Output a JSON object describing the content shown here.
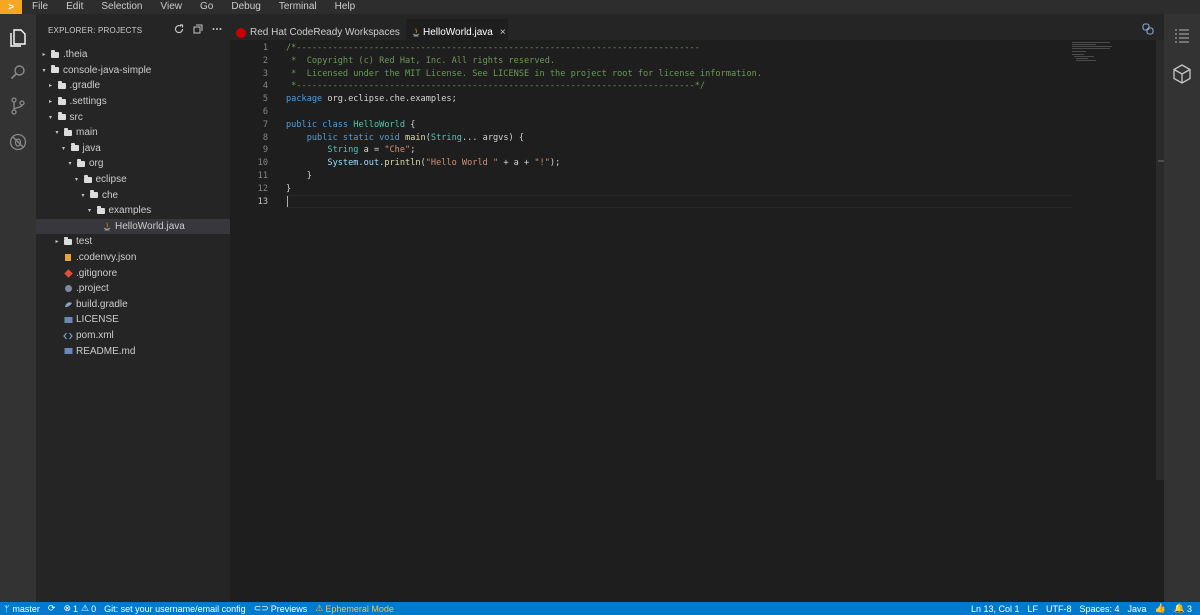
{
  "menu": {
    "logo": ">",
    "items": [
      "File",
      "Edit",
      "Selection",
      "View",
      "Go",
      "Debug",
      "Terminal",
      "Help"
    ]
  },
  "activity_bar": {
    "icons": [
      "files-icon",
      "search-icon",
      "source-control-icon",
      "debug-icon"
    ]
  },
  "sidebar": {
    "title": "EXPLORER: PROJECTS",
    "tree": [
      {
        "label": ".theia",
        "depth": 0,
        "kind": "folder",
        "state": "collapsed"
      },
      {
        "label": "console-java-simple",
        "depth": 0,
        "kind": "folder",
        "state": "expanded"
      },
      {
        "label": ".gradle",
        "depth": 1,
        "kind": "folder",
        "state": "collapsed"
      },
      {
        "label": ".settings",
        "depth": 1,
        "kind": "folder",
        "state": "collapsed"
      },
      {
        "label": "src",
        "depth": 1,
        "kind": "folder",
        "state": "expanded"
      },
      {
        "label": "main",
        "depth": 2,
        "kind": "folder",
        "state": "expanded"
      },
      {
        "label": "java",
        "depth": 3,
        "kind": "folder",
        "state": "expanded"
      },
      {
        "label": "org",
        "depth": 4,
        "kind": "folder",
        "state": "expanded"
      },
      {
        "label": "eclipse",
        "depth": 5,
        "kind": "folder",
        "state": "expanded"
      },
      {
        "label": "che",
        "depth": 6,
        "kind": "folder",
        "state": "expanded"
      },
      {
        "label": "examples",
        "depth": 7,
        "kind": "folder",
        "state": "expanded"
      },
      {
        "label": "HelloWorld.java",
        "depth": 8,
        "kind": "java",
        "state": "selected"
      },
      {
        "label": "test",
        "depth": 2,
        "kind": "folder",
        "state": "collapsed"
      },
      {
        "label": ".codenvy.json",
        "depth": 2,
        "kind": "json",
        "state": ""
      },
      {
        "label": ".gitignore",
        "depth": 2,
        "kind": "git",
        "state": ""
      },
      {
        "label": ".project",
        "depth": 2,
        "kind": "project",
        "state": ""
      },
      {
        "label": "build.gradle",
        "depth": 2,
        "kind": "gradle",
        "state": ""
      },
      {
        "label": "LICENSE",
        "depth": 2,
        "kind": "text",
        "state": ""
      },
      {
        "label": "pom.xml",
        "depth": 2,
        "kind": "xml",
        "state": ""
      },
      {
        "label": "README.md",
        "depth": 2,
        "kind": "text",
        "state": ""
      }
    ]
  },
  "tabs": [
    {
      "label": "Red Hat CodeReady Workspaces",
      "active": false
    },
    {
      "label": "HelloWorld.java",
      "active": true,
      "close": "×"
    }
  ],
  "editor": {
    "line_numbers": [
      "1",
      "2",
      "3",
      "4",
      "5",
      "6",
      "7",
      "8",
      "9",
      "10",
      "11",
      "12",
      "13"
    ],
    "current_line": 13
  },
  "code": {
    "l1": "/*------------------------------------------------------------------------------",
    "l2": " *  Copyright (c) Red Hat, Inc. All rights reserved.",
    "l3": " *  Licensed under the MIT License. See LICENSE in the project root for license information.",
    "l4": " *-----------------------------------------------------------------------------*/",
    "l5_kw": "package",
    "l5_rest": " org.eclipse.che.examples;",
    "l7_kw": "public class",
    "l7_name": "HelloWorld",
    "l7_rest": " {",
    "l8_kw": "    public static void",
    "l8_fn": "main",
    "l8_rest1": "(",
    "l8_type": "String",
    "l8_rest2": "... argvs) {",
    "l9_type": "        String",
    "l9_rest": " a = ",
    "l9_str": "\"Che\"",
    "l9_end": ";",
    "l10_obj": "        System.out.",
    "l10_fn": "println",
    "l10_rest1": "(",
    "l10_str1": "\"Hello World \"",
    "l10_rest2": " + a + ",
    "l10_str2": "\"!\"",
    "l10_rest3": ");",
    "l11": "    }",
    "l12": "}"
  },
  "statusbar": {
    "branch": "master",
    "errors": "1",
    "warnings": "0",
    "git_msg": "Git: set your username/email config",
    "previews": "Previews",
    "ephemeral": "Ephemeral Mode",
    "position": "Ln 13, Col 1",
    "eol": "LF",
    "encoding": "UTF-8",
    "spaces": "Spaces: 4",
    "language": "Java",
    "notifications": "3"
  },
  "colors": {
    "accent": "#007acc",
    "logo": "#f5a623",
    "warning": "#f5c242"
  }
}
